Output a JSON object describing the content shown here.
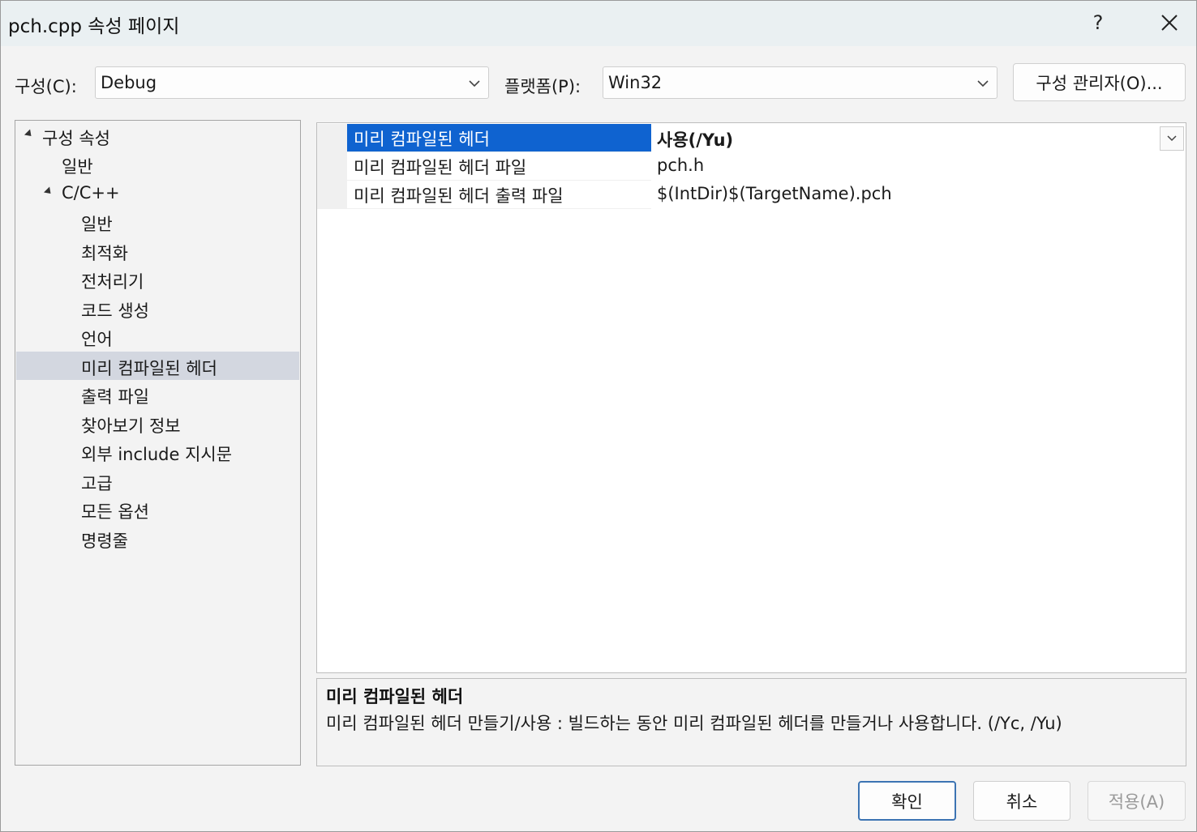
{
  "window": {
    "title": "pch.cpp 속성 페이지",
    "help_label": "?"
  },
  "config": {
    "label": "구성(C):",
    "value": "Debug"
  },
  "platform": {
    "label": "플랫폼(P):",
    "value": "Win32"
  },
  "config_manager_label": "구성 관리자(O)...",
  "tree": {
    "items": [
      {
        "label": "구성 속성"
      },
      {
        "label": "일반"
      },
      {
        "label": "C/C++"
      },
      {
        "label": "일반"
      },
      {
        "label": "최적화"
      },
      {
        "label": "전처리기"
      },
      {
        "label": "코드 생성"
      },
      {
        "label": "언어"
      },
      {
        "label": "미리 컴파일된 헤더"
      },
      {
        "label": "출력 파일"
      },
      {
        "label": "찾아보기 정보"
      },
      {
        "label": "외부 include 지시문"
      },
      {
        "label": "고급"
      },
      {
        "label": "모든 옵션"
      },
      {
        "label": "명령줄"
      }
    ],
    "selected_label": "미리 컴파일된 헤더"
  },
  "properties": {
    "rows": [
      {
        "name": "미리 컴파일된 헤더",
        "value": "사용(/Yu)"
      },
      {
        "name": "미리 컴파일된 헤더 파일",
        "value": "pch.h"
      },
      {
        "name": "미리 컴파일된 헤더 출력 파일",
        "value": "$(IntDir)$(TargetName).pch"
      }
    ]
  },
  "description": {
    "title": "미리 컴파일된 헤더",
    "body": "미리 컴파일된 헤더 만들기/사용 : 빌드하는 동안 미리 컴파일된 헤더를 만들거나 사용합니다.     (/Yc, /Yu)"
  },
  "buttons": {
    "ok": "확인",
    "cancel": "취소",
    "apply": "적용(A)"
  }
}
